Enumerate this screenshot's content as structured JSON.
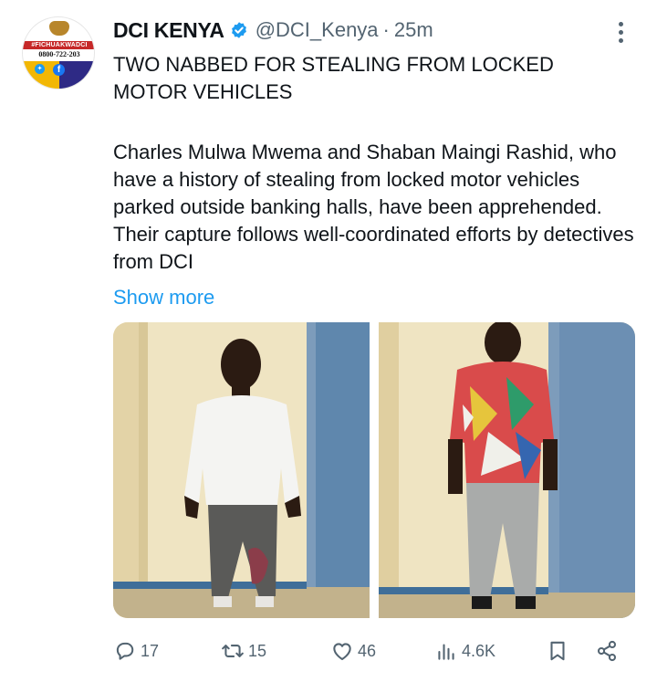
{
  "tweet": {
    "author": {
      "display_name": "DCI KENYA",
      "handle": "@DCI_Kenya",
      "separator": "·",
      "time": "25m",
      "verified": true,
      "avatar": {
        "banner_text": "#FICHUAKWADCI",
        "phone_text": "0800-722-203"
      }
    },
    "title": "TWO NABBED FOR STEALING FROM LOCKED\nMOTOR VEHICLES",
    "body": "Charles Mulwa Mwema and Shaban Maingi Rashid, who have a history of stealing from locked motor vehicles parked outside banking halls, have been apprehended. Their capture follows well-coordinated efforts by detectives from DCI",
    "show_more": "Show more",
    "media": [
      {
        "description": "man-in-white-shirt"
      },
      {
        "description": "man-in-patterned-shirt"
      }
    ],
    "stats": {
      "replies": "17",
      "retweets": "15",
      "likes": "46",
      "views": "4.6K"
    }
  },
  "colors": {
    "accent": "#1d9bf0",
    "muted": "#536471",
    "text": "#0f1419"
  }
}
